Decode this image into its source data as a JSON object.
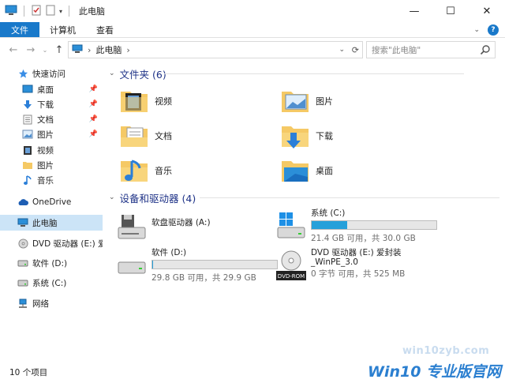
{
  "window": {
    "title": "此电脑",
    "minimize": "—",
    "maximize": "☐",
    "close": "✕"
  },
  "ribbon": {
    "tabs": [
      "文件",
      "计算机",
      "查看"
    ]
  },
  "address": {
    "path": "此电脑",
    "separator": "›",
    "search_placeholder": "搜索\"此电脑\""
  },
  "navpane": {
    "quick_access": "快速访问",
    "quick_items": [
      {
        "label": "桌面",
        "pinned": true
      },
      {
        "label": "下载",
        "pinned": true
      },
      {
        "label": "文档",
        "pinned": true
      },
      {
        "label": "图片",
        "pinned": true
      },
      {
        "label": "视频",
        "pinned": false
      },
      {
        "label": "图片",
        "pinned": false
      },
      {
        "label": "音乐",
        "pinned": false
      }
    ],
    "onedrive": "OneDrive",
    "this_pc": "此电脑",
    "dvd": "DVD 驱动器 (E:) 爱封",
    "soft": "软件 (D:)",
    "system": "系统 (C:)",
    "network": "网络"
  },
  "folders_group": {
    "header": "文件夹 (6)",
    "items": [
      "视频",
      "图片",
      "文档",
      "下载",
      "音乐",
      "桌面"
    ]
  },
  "drives_group": {
    "header": "设备和驱动器 (4)",
    "floppy": {
      "name": "软盘驱动器 (A:)"
    },
    "c": {
      "name": "系统 (C:)",
      "free": "21.4 GB 可用，共 30.0 GB",
      "used_fraction": 0.287
    },
    "d": {
      "name": "软件 (D:)",
      "free": "29.8 GB 可用，共 29.9 GB",
      "used_fraction": 0.003
    },
    "e": {
      "name": "DVD 驱动器 (E:) 爱封装",
      "name2": "_WinPE_3.0",
      "free": "0 字节 可用，共 525 MB",
      "badge": "DVD-ROM"
    }
  },
  "status": {
    "count": "10 个项目"
  },
  "watermark": {
    "url": "win10zyb.com",
    "brand": "Win10 专业版官网"
  },
  "colors": {
    "accent": "#1979ca",
    "bar_fill": "#26a0da",
    "group_header": "#1e3287"
  }
}
